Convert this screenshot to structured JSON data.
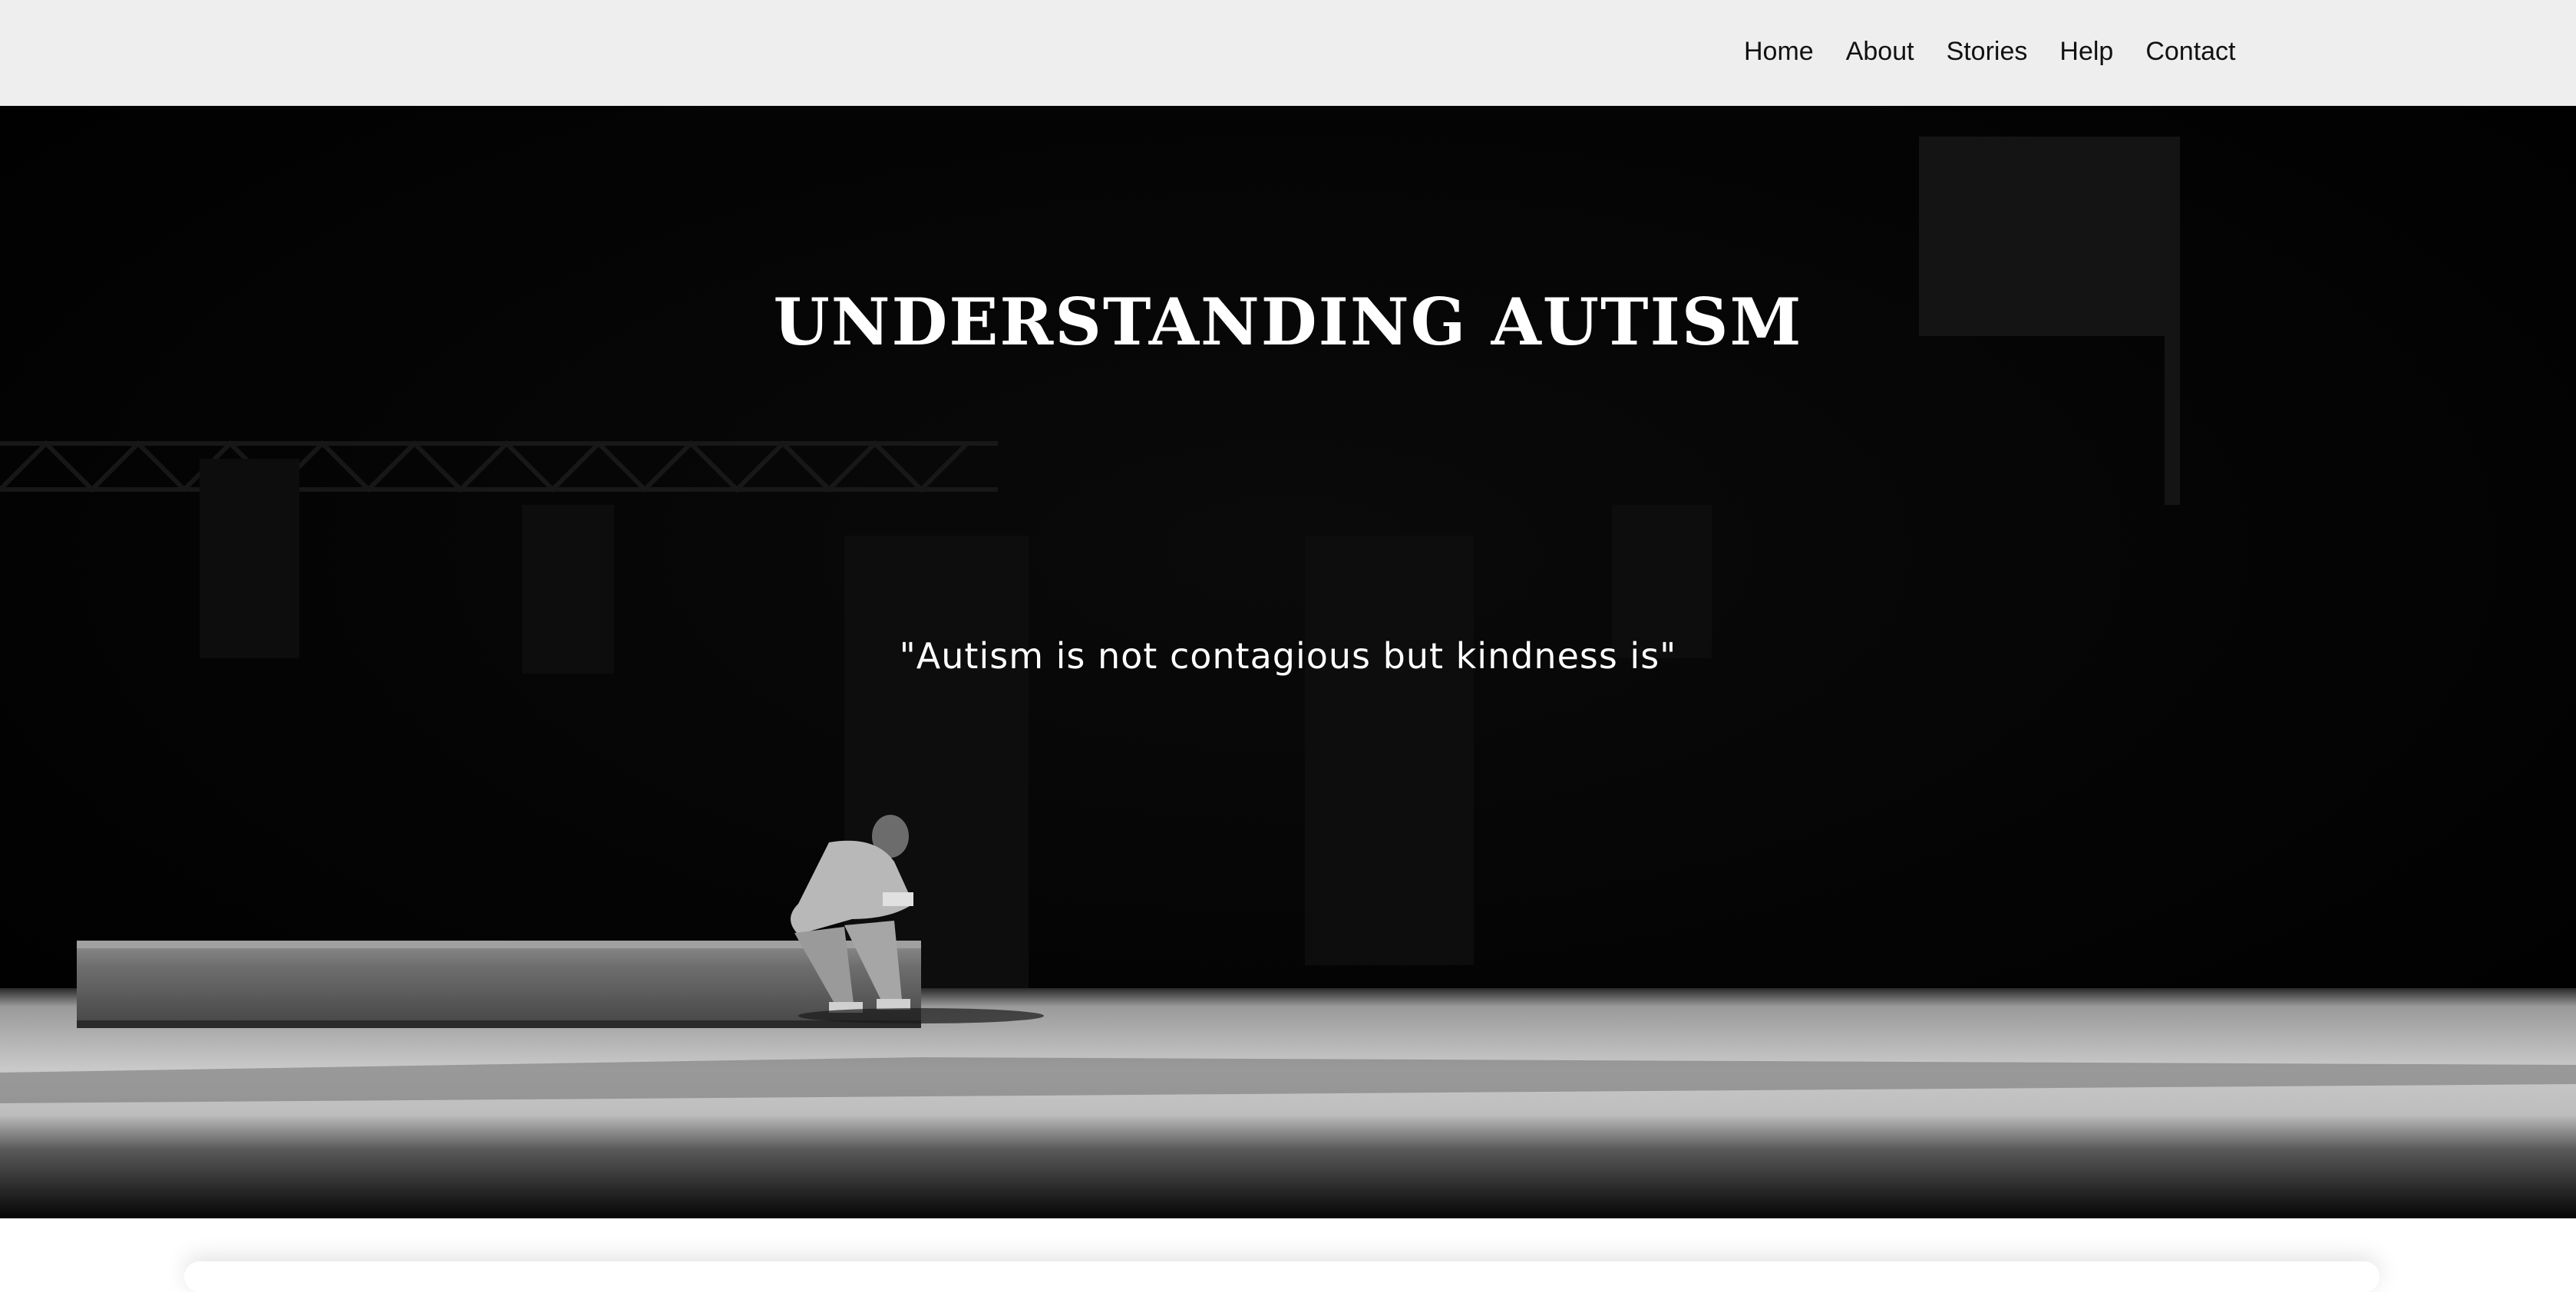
{
  "nav": {
    "items": [
      {
        "label": "Home"
      },
      {
        "label": "About"
      },
      {
        "label": "Stories"
      },
      {
        "label": "Help"
      },
      {
        "label": "Contact"
      }
    ]
  },
  "hero": {
    "title": "UNDERSTANDING AUTISM",
    "quote": "\"Autism is not contagious but kindness is\"",
    "image_icon": "person-on-bench-photo"
  },
  "colors": {
    "navbar_bg": "#eeeeee",
    "hero_bg": "#000000",
    "hero_text": "#ffffff",
    "nav_text": "#111111"
  }
}
